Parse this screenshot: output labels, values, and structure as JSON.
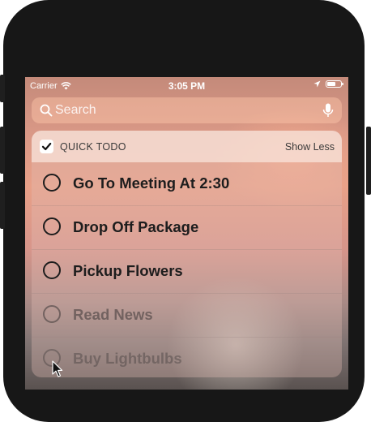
{
  "status_bar": {
    "carrier": "Carrier",
    "time": "3:05 PM",
    "icons": [
      "wifi-icon",
      "location-icon",
      "battery-icon"
    ]
  },
  "search": {
    "placeholder": "Search",
    "icons": [
      "search-icon",
      "microphone-icon"
    ]
  },
  "widget": {
    "title": "QUICK TODO",
    "show_less_label": "Show Less",
    "app_icon": "checkmark-icon",
    "items": [
      {
        "label": "Go To Meeting At 2:30"
      },
      {
        "label": "Drop Off Package"
      },
      {
        "label": "Pickup Flowers"
      },
      {
        "label": "Read News"
      },
      {
        "label": "Buy Lightbulbs"
      }
    ]
  },
  "colors": {
    "text_dark": "#1d1d1d",
    "header_bg": "#fae6dc",
    "wallpaper_peach": "#e8a088"
  }
}
